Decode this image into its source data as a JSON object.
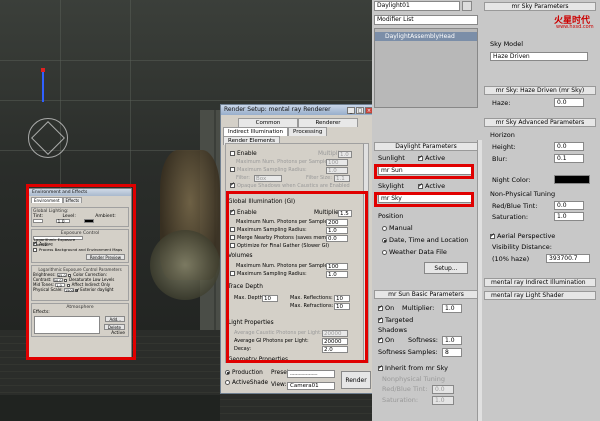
{
  "modify": {
    "object_name": "Daylight01",
    "modifier_list": "Modifier List",
    "stack_item": "DaylightAssemblyHead",
    "daylight_params_title": "Daylight Parameters",
    "sunlight_label": "Sunlight",
    "sunlight_active": "Active",
    "sunlight_value": "mr Sun",
    "skylight_label": "Skylight",
    "skylight_active": "Active",
    "skylight_value": "mr Sky",
    "position_label": "Position",
    "pos_manual": "Manual",
    "pos_datetime": "Date, Time and Location",
    "pos_weather": "Weather Data File",
    "setup_btn": "Setup...",
    "sun_basic_title": "mr Sun Basic Parameters",
    "on_label": "On",
    "multiplier_label": "Multiplier:",
    "multiplier_value": "1.0",
    "targeted_label": "Targeted",
    "shadows_label": "Shadows",
    "shadows_on": "On",
    "softness_label": "Softness:",
    "softness_value": "1.0",
    "softness_samples_label": "Softness Samples:",
    "softness_samples_value": "8",
    "inherit_label": "Inherit from mr Sky",
    "np_tuning": "Nonphysical Tuning",
    "rb_tint": "Red/Blue Tint:",
    "rb_tint_value": "0.0",
    "saturation": "Saturation:",
    "saturation_value": "1.0"
  },
  "mrsky": {
    "title": "mr Sky Parameters",
    "sky_model_label": "Sky Model",
    "sky_model_value": "Haze Driven",
    "haze_title": "mr Sky: Haze Driven (mr Sky)",
    "haze_label": "Haze:",
    "haze_value": "0.0",
    "advanced_title": "mr Sky Advanced Parameters",
    "horizon_label": "Horizon",
    "height_label": "Height:",
    "height_value": "0.0",
    "blur_label": "Blur:",
    "blur_value": "0.1",
    "night_color_label": "Night Color:",
    "nonphys_label": "Non-Physical Tuning",
    "rb_tint_label": "Red/Blue Tint:",
    "rb_tint_value": "0.0",
    "saturation_label": "Saturation:",
    "saturation_value": "1.0",
    "aerial_label": "Aerial Perspective",
    "visibility_label": "Visibility Distance:",
    "haze_pct_label": "(10% haze)",
    "visibility_value": "393700.7",
    "ind_illum_title": "mental ray Indirect Illumination",
    "light_shader_title": "mental ray Light Shader",
    "watermark": "火星时代",
    "watermark_url": "www.hxsd.com"
  },
  "render_setup": {
    "title": "Render Setup: mental ray Renderer",
    "tabs": [
      "Common",
      "Renderer",
      "Indirect Illumination",
      "Processing",
      "Render Elements"
    ],
    "caustics_enable": "Enable",
    "caustics_multiplier": "Multiplier:",
    "caustics_mult_value": "1.0",
    "caustics_max_photons": "Maximum Num. Photons per Sample:",
    "caustics_max_photons_value": "100",
    "caustics_max_radius": "Maximum Sampling Radius:",
    "caustics_max_radius_value": "1.0",
    "caustics_filter": "Filter:",
    "caustics_filter_value": "Box",
    "caustics_filter_size": "Filter Size:",
    "caustics_filter_size_value": "1.1",
    "caustics_opaque": "Opaque Shadows when Caustics are Enabled",
    "gi_title": "Global Illumination (GI)",
    "gi_enable": "Enable",
    "gi_multiplier": "Multiplier:",
    "gi_mult_value": "1.5",
    "gi_max_photons": "Maximum Num. Photons per Sample:",
    "gi_max_photons_value": "200",
    "gi_max_radius": "Maximum Sampling Radius:",
    "gi_max_radius_value": "1.0",
    "gi_merge": "Merge Nearby Photons (saves memory):",
    "gi_merge_value": "0.0",
    "gi_optimize": "Optimize for Final Gather (Slower GI)",
    "vol_title": "Volumes",
    "vol_max_photons": "Maximum Num. Photons per Sample:",
    "vol_max_photons_value": "100",
    "vol_max_radius": "Maximum Sampling Radius:",
    "vol_max_radius_value": "1.0",
    "trace_title": "Trace Depth",
    "max_depth": "Max. Depth:",
    "max_depth_value": "10",
    "max_reflections": "Max. Reflections:",
    "max_reflections_value": "10",
    "max_refractions": "Max. Refractions:",
    "max_refractions_value": "10",
    "lp_title": "Light Properties",
    "lp_avg_caustic": "Average Caustic Photons per Light:",
    "lp_avg_caustic_value": "20000",
    "lp_avg_gi": "Average GI Photons per Light:",
    "lp_avg_gi_value": "20000",
    "lp_decay": "Decay:",
    "lp_decay_value": "2.0",
    "geometry_title": "Geometry Properties",
    "production": "Production",
    "activeshade": "ActiveShade",
    "preset_label": "Preset:",
    "preset_value": "-------------------",
    "view_label": "View:",
    "view_value": "Camera01",
    "render_btn": "Render"
  },
  "env": {
    "title": "Environment and Effects",
    "tabs": [
      "Environment",
      "Effects"
    ],
    "global_lighting": "Global Lighting:",
    "tint": "Tint:",
    "level": "Level:",
    "level_value": "1.0",
    "ambient": "Ambient:",
    "exposure_title": "Exposure Control",
    "exposure_value": "Logarithmic Exposure Control",
    "active": "Active",
    "process_bg": "Process Background and Environment Maps",
    "render_preview": "Render Preview",
    "log_params_title": "Logarithmic Exposure Control Parameters",
    "brightness": "Brightness:",
    "brightness_value": "65.0",
    "contrast": "Contrast:",
    "contrast_value": "50.0",
    "mid_tones": "Mid Tones:",
    "mid_tones_value": "1.0",
    "physical_scale": "Physical Scale:",
    "physical_scale_value": "1500.0",
    "color_correction": "Color Correction:",
    "desaturate": "Desaturate Low Levels",
    "affect_indirect": "Affect Indirect Only",
    "exterior_daylight": "Exterior daylight",
    "atmosphere_title": "Atmosphere",
    "effects_label": "Effects:",
    "add_btn": "Add...",
    "delete_btn": "Delete",
    "active2": "Active"
  }
}
